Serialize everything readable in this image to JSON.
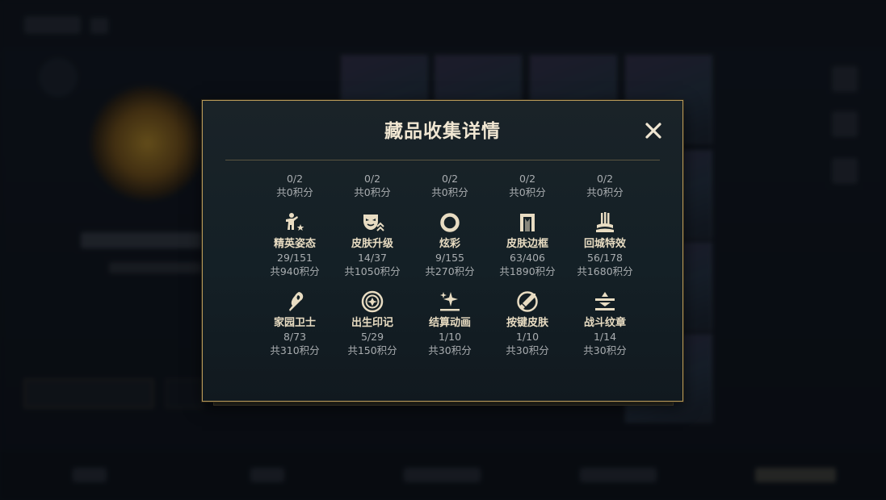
{
  "modal": {
    "title": "藏品收集详情",
    "close_icon": "close-icon"
  },
  "partial_row": [
    {
      "progress": "0/2",
      "points": "共0积分"
    },
    {
      "progress": "0/2",
      "points": "共0积分"
    },
    {
      "progress": "0/2",
      "points": "共0积分"
    },
    {
      "progress": "0/2",
      "points": "共0积分"
    },
    {
      "progress": "0/2",
      "points": "共0积分"
    }
  ],
  "categories": [
    {
      "icon": "emote-pose-icon",
      "name": "精英姿态",
      "progress": "29/151",
      "points": "共940积分"
    },
    {
      "icon": "mask-upgrade-icon",
      "name": "皮肤升级",
      "progress": "14/37",
      "points": "共1050积分"
    },
    {
      "icon": "ring-icon",
      "name": "炫彩",
      "progress": "9/155",
      "points": "共270积分"
    },
    {
      "icon": "frame-icon",
      "name": "皮肤边框",
      "progress": "63/406",
      "points": "共1890积分"
    },
    {
      "icon": "recall-effect-icon",
      "name": "回城特效",
      "progress": "56/178",
      "points": "共1680积分"
    },
    {
      "icon": "guardian-icon",
      "name": "家园卫士",
      "progress": "8/73",
      "points": "共310积分"
    },
    {
      "icon": "birth-mark-icon",
      "name": "出生印记",
      "progress": "5/29",
      "points": "共150积分"
    },
    {
      "icon": "settlement-animation-icon",
      "name": "结算动画",
      "progress": "1/10",
      "points": "共30积分"
    },
    {
      "icon": "button-skin-icon",
      "name": "按键皮肤",
      "progress": "1/10",
      "points": "共30积分"
    },
    {
      "icon": "battle-emblem-icon",
      "name": "战斗纹章",
      "progress": "1/14",
      "points": "共30积分"
    }
  ],
  "colors": {
    "accent_gold": "#b89a5a",
    "title_text": "#f0e6d2",
    "label_text": "#e8dcc2",
    "muted_text": "#a9adb0",
    "panel_bg": "#142026"
  }
}
